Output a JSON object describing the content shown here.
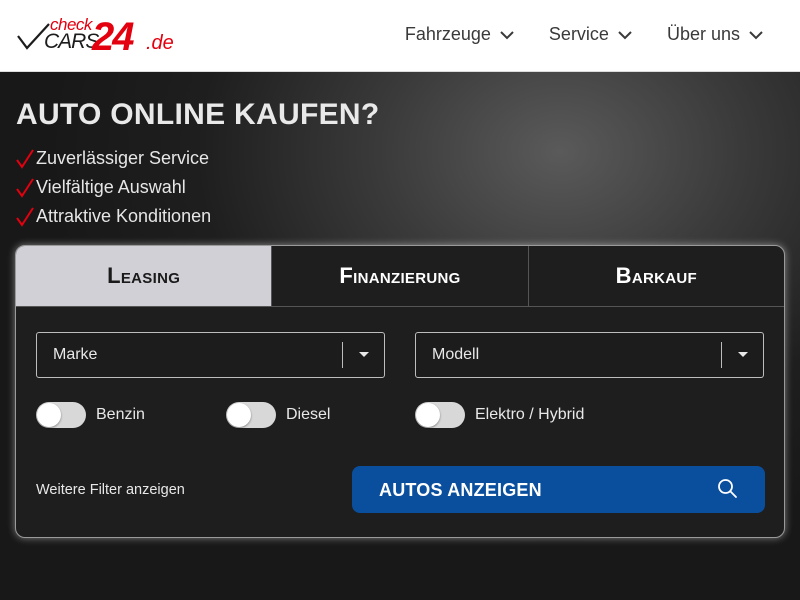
{
  "logo": {
    "check": "check",
    "cars": "CARS",
    "number": "24",
    "tld": ".de"
  },
  "nav": {
    "items": [
      {
        "label": "Fahrzeuge"
      },
      {
        "label": "Service"
      },
      {
        "label": "Über uns"
      }
    ]
  },
  "hero": {
    "title": "AUTO ONLINE KAUFEN?",
    "benefits": [
      "Zuverlässiger Service",
      "Vielfältige Auswahl",
      "Attraktive Konditionen"
    ]
  },
  "search": {
    "tabs": [
      {
        "label": "Leasing",
        "active": true
      },
      {
        "label": "Finanzierung",
        "active": false
      },
      {
        "label": "Barkauf",
        "active": false
      }
    ],
    "make_select": {
      "value": "Marke"
    },
    "model_select": {
      "value": "Modell"
    },
    "fuel_toggles": [
      {
        "label": "Benzin",
        "on": false
      },
      {
        "label": "Diesel",
        "on": false
      },
      {
        "label": "Elektro / Hybrid",
        "on": false
      }
    ],
    "more_filters_label": "Weitere Filter anzeigen",
    "submit_label": "AUTOS ANZEIGEN"
  },
  "colors": {
    "brand_red": "#e3000f",
    "button_blue": "#0a4f9e",
    "active_tab": "#d0d0d6"
  },
  "icons": {
    "nav_chevron": "chevron-down-icon",
    "benefit": "checkmark-icon",
    "submit": "search-icon"
  }
}
